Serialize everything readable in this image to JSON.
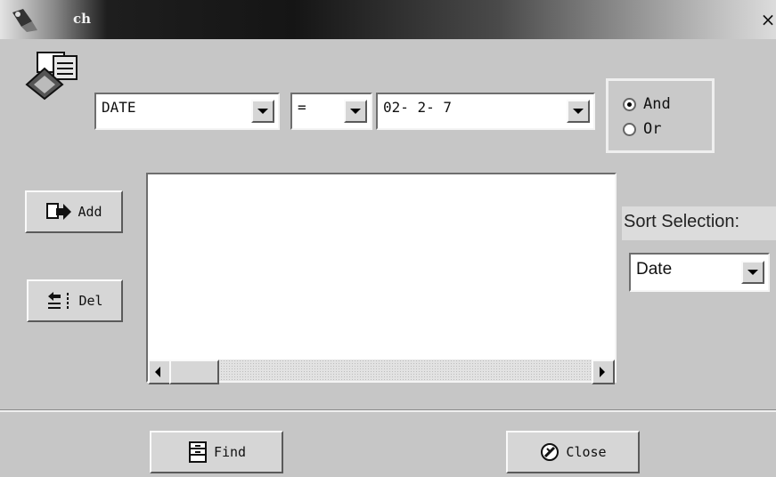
{
  "window": {
    "title": "ch",
    "close_glyph": "×"
  },
  "criteria": {
    "field": {
      "value": "DATE",
      "icon": "dropdown-arrow-icon"
    },
    "operator": {
      "value": "=",
      "icon": "dropdown-arrow-icon"
    },
    "value": {
      "value": "02- 2- 7",
      "icon": "dropdown-arrow-icon"
    }
  },
  "logic": {
    "options": [
      {
        "label": "And",
        "selected": true
      },
      {
        "label": "Or",
        "selected": false
      }
    ]
  },
  "buttons": {
    "add": "Add",
    "del": "Del",
    "find": "Find",
    "close": "Close"
  },
  "sort": {
    "label": "Sort Selection:",
    "value": "Date"
  },
  "colors": {
    "face": "#c6c6c6",
    "titlebar_dark": "#151515",
    "field_bg": "#ffffff"
  }
}
